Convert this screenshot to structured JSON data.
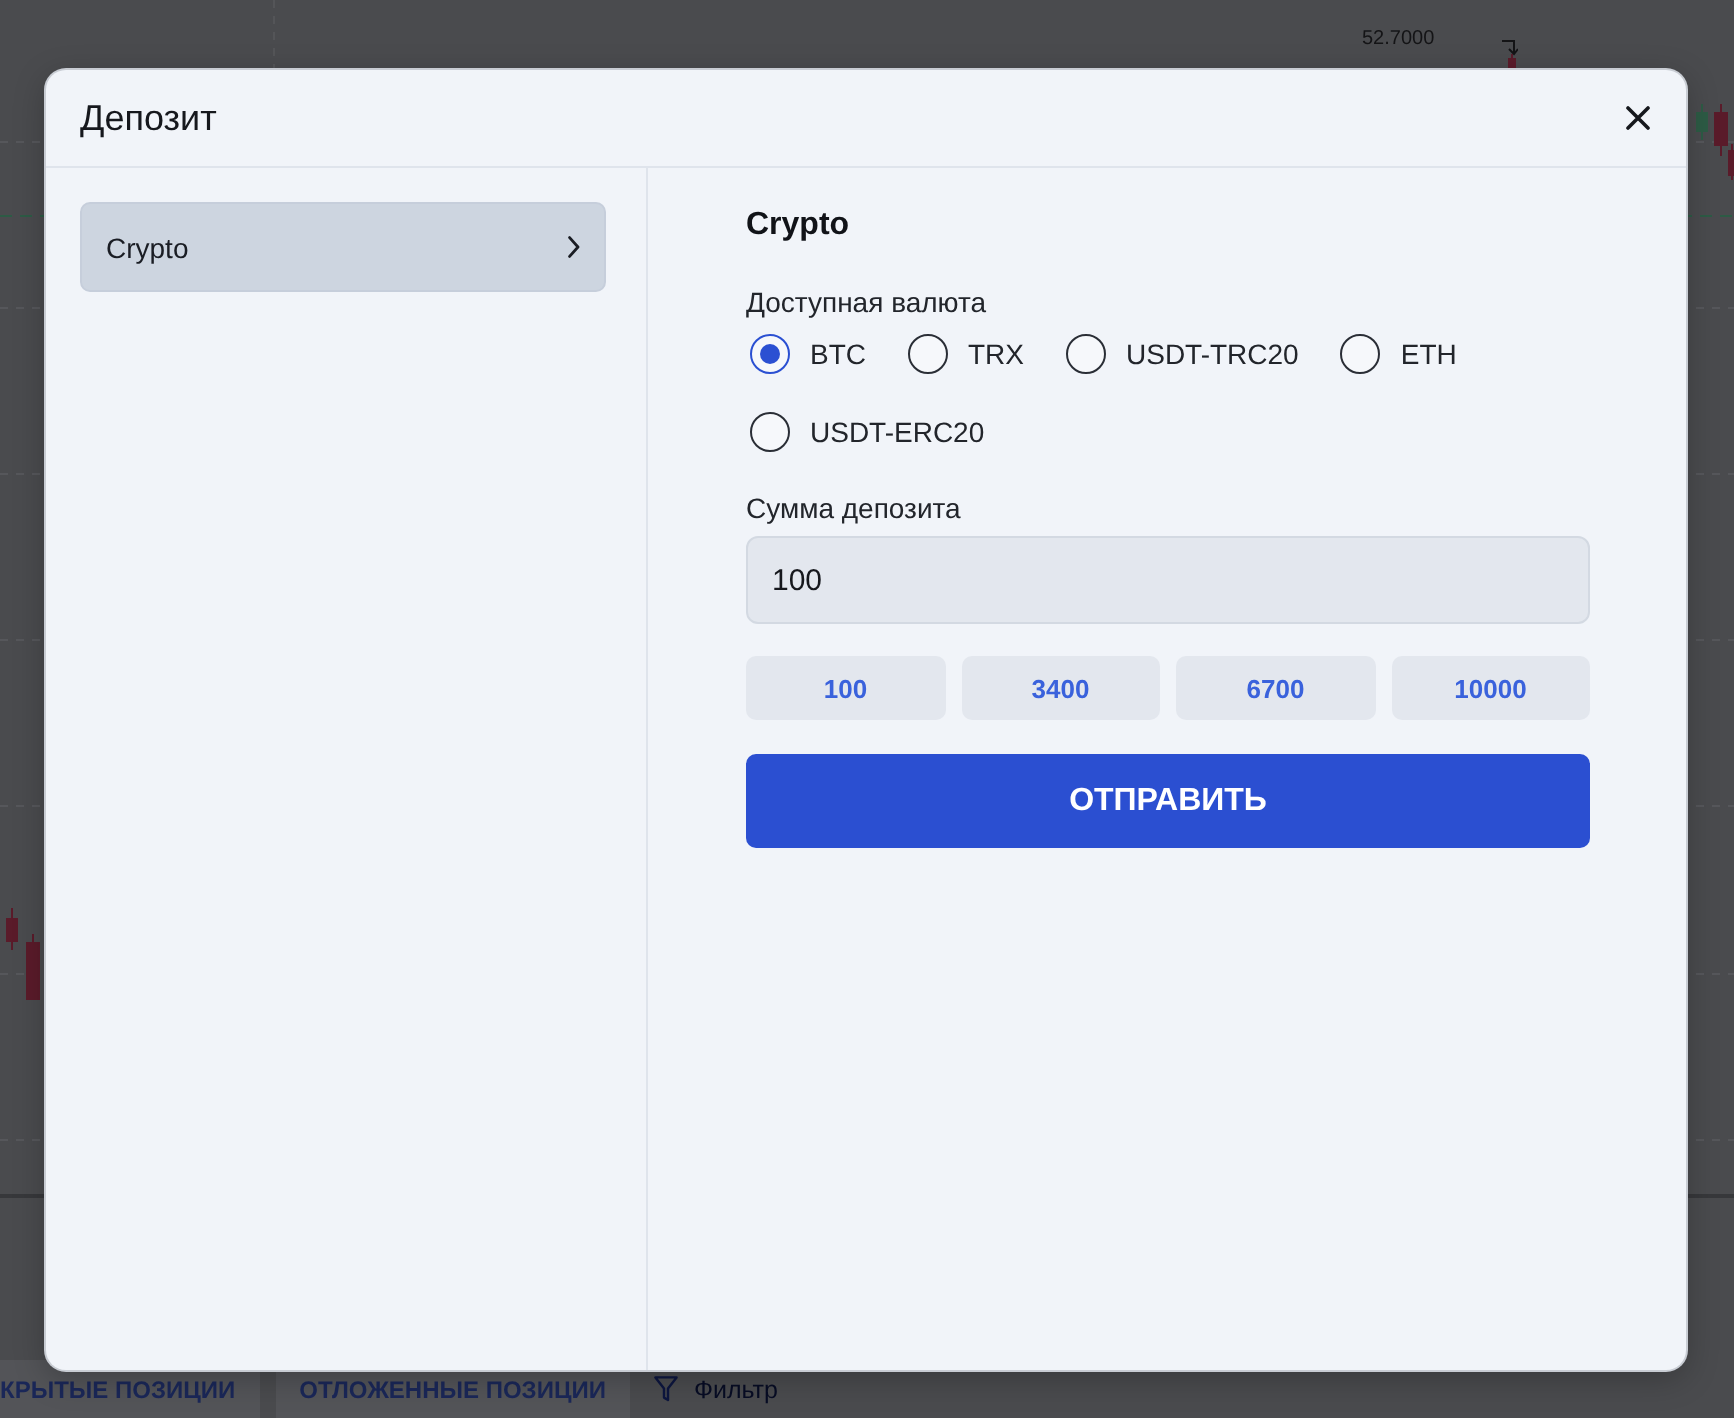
{
  "chart": {
    "price_label": "52.7000"
  },
  "positions_bar": {
    "tabs": [
      "КРЫТЫЕ ПОЗИЦИИ",
      "ОТЛОЖЕННЫЕ ПОЗИЦИИ"
    ],
    "filter": "Фильтр"
  },
  "dialog": {
    "title": "Депозит",
    "methods": [
      {
        "label": "Crypto",
        "selected": true
      }
    ],
    "section_title": "Crypto",
    "currency_label": "Доступная валюта",
    "currencies": [
      {
        "label": "BTC",
        "selected": true
      },
      {
        "label": "TRX",
        "selected": false
      },
      {
        "label": "USDT-TRC20",
        "selected": false
      },
      {
        "label": "ETH",
        "selected": false
      },
      {
        "label": "USDT-ERC20",
        "selected": false
      }
    ],
    "amount_label": "Сумма депозита",
    "amount": {
      "value": "100"
    },
    "presets": [
      "100",
      "3400",
      "6700",
      "10000"
    ],
    "submit": "ОТПРАВИТЬ"
  }
}
